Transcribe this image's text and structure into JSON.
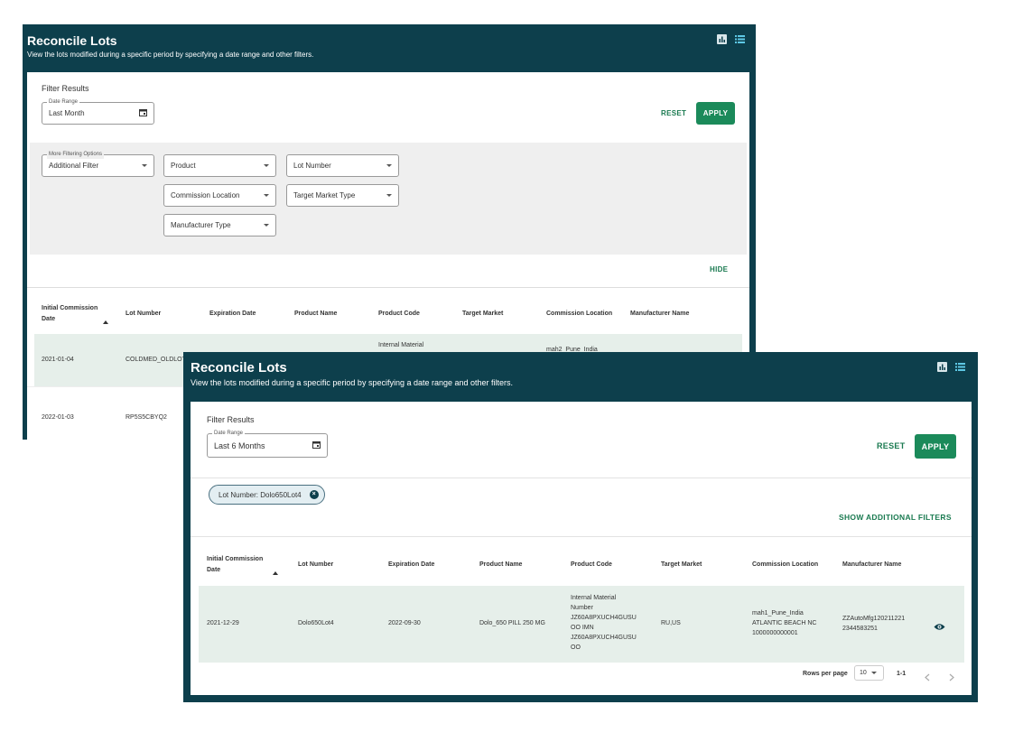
{
  "back": {
    "title": "Reconcile Lots",
    "subtitle": "View the lots modified during a specific period by specifying a date range and other filters.",
    "filter_results_label": "Filter Results",
    "date_range": {
      "legend": "Date Range",
      "value": "Last Month"
    },
    "reset_label": "RESET",
    "apply_label": "APPLY",
    "more_filtering": {
      "legend": "More Filtering Options",
      "value": "Additional Filter"
    },
    "filters": {
      "product": "Product",
      "lot_number": "Lot Number",
      "commission_location": "Commission Location",
      "target_market_type": "Target Market Type",
      "manufacturer_type": "Manufacturer Type"
    },
    "hide_label": "HIDE",
    "columns": [
      "Initial Commission Date",
      "Lot Number",
      "Expiration Date",
      "Product Name",
      "Product Code",
      "Target Market",
      "Commission Location",
      "Manufacturer Name"
    ],
    "rows": [
      {
        "date": "2021-01-04",
        "lot": "COLDMED_OLDLOT",
        "code": "Internal Material",
        "location": "mah2_Pune_India"
      },
      {
        "date": "2022-01-03",
        "lot": "RP5S5CBYQ2"
      }
    ]
  },
  "front": {
    "title": "Reconcile Lots",
    "subtitle": "View the lots modified during a specific period by specifying a date range and other filters.",
    "filter_results_label": "Filter Results",
    "date_range": {
      "legend": "Date Range",
      "value": "Last 6 Months"
    },
    "reset_label": "RESET",
    "apply_label": "APPLY",
    "chip_label": "Lot Number: Dolo650Lot4",
    "show_filters_label": "SHOW ADDITIONAL FILTERS",
    "columns": [
      "Initial Commission Date",
      "Lot Number",
      "Expiration Date",
      "Product Name",
      "Product Code",
      "Target Market",
      "Commission Location",
      "Manufacturer Name"
    ],
    "row": {
      "date": "2021-12-29",
      "lot": "Dolo650Lot4",
      "expiration": "2022-09-30",
      "product_name": "Dolo_650 PILL 250 MG",
      "product_code_lines": [
        "Internal Material",
        "Number",
        "JZ60A8PXUCH4GUSU",
        "OO IMN",
        "JZ60A8PXUCH4GUSU",
        "OO"
      ],
      "target_market": "RU,US",
      "location_lines": [
        "mah1_Pune_India",
        "ATLANTIC BEACH NC",
        "1000000000001"
      ],
      "manufacturer_lines": [
        "ZZAutoMfg120211221",
        "2344583251"
      ]
    },
    "pagination": {
      "rows_per_page_label": "Rows per page",
      "rows_per_page": "10",
      "range": "1-1"
    }
  },
  "icons": {
    "chart": "bar-chart-icon",
    "list": "list-icon",
    "view": "eye-icon",
    "calendar": "calendar-icon",
    "sort": "sort-up-icon"
  }
}
